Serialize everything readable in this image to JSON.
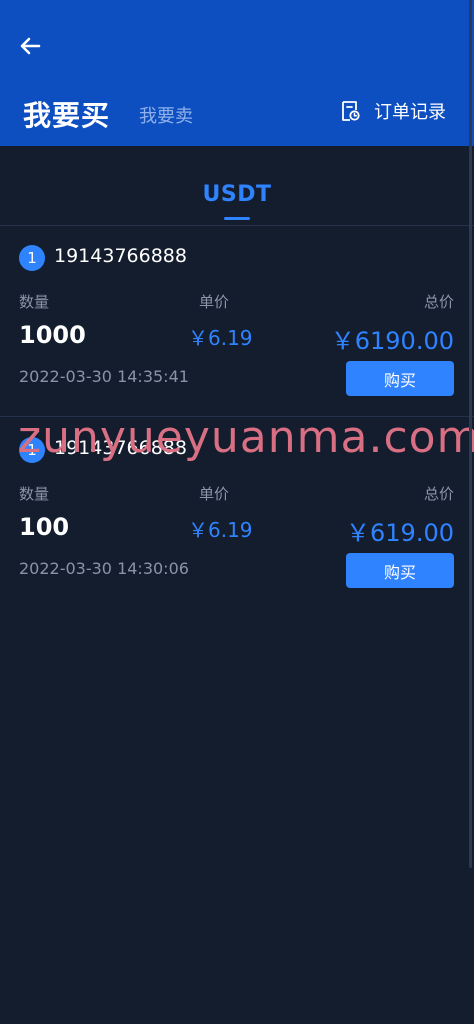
{
  "header": {
    "tab_buy": "我要买",
    "tab_sell": "我要卖",
    "orders_label": "订单记录",
    "bg_color": "#0d4fc1"
  },
  "coin_tab": {
    "label": "USDT"
  },
  "labels": {
    "quantity": "数量",
    "unit_price": "单价",
    "total": "总价"
  },
  "listings": [
    {
      "rank": "1",
      "phone": "19143766888",
      "quantity": "1000",
      "unit_price": "￥6.19",
      "total": "￥6190.00",
      "date": "2022-03-30 14:35:41",
      "buy_label": "购买"
    },
    {
      "rank": "1",
      "phone": "19143766888",
      "quantity": "100",
      "unit_price": "￥6.19",
      "total": "￥619.00",
      "date": "2022-03-30 14:30:06",
      "buy_label": "购买"
    }
  ],
  "watermark": "zunyueyuanma.com",
  "colors": {
    "accent": "#2f83ff",
    "background": "#131d2e"
  }
}
